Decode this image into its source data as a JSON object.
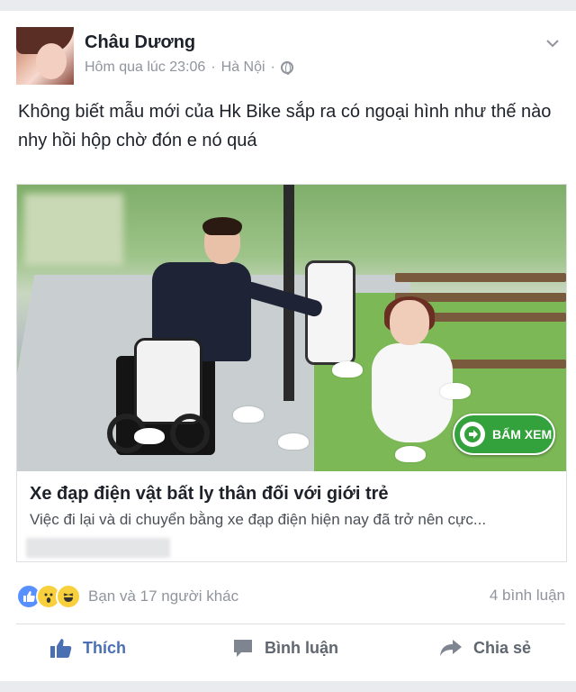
{
  "post": {
    "author": "Châu Dương",
    "timestamp": "Hôm qua lúc 23:06",
    "separator": "·",
    "location": "Hà Nội",
    "privacy_icon": "globe-icon",
    "text": "Không biết mẫu mới của Hk Bike sắp ra có ngoại hình như thế nào nhy hồi hộp chờ đón e nó quá"
  },
  "link_preview": {
    "cta_label": "BẤM XEM",
    "title": "Xe đạp điện vật bất ly thân đối với giới trẻ",
    "description": "Việc đi lại và di chuyển bằng xe đạp điện hiện nay đã trở nên cực..."
  },
  "engagement": {
    "reactions": [
      "like-icon",
      "wow-icon",
      "haha-icon"
    ],
    "reaction_summary": "Bạn và 17 người khác",
    "comment_count": "4 bình luận"
  },
  "actions": {
    "like": "Thích",
    "comment": "Bình luận",
    "share": "Chia sẻ"
  },
  "colors": {
    "like_blue": "#4b6fb3",
    "cta_green": "#33a23c",
    "muted_gray": "#90949c"
  }
}
